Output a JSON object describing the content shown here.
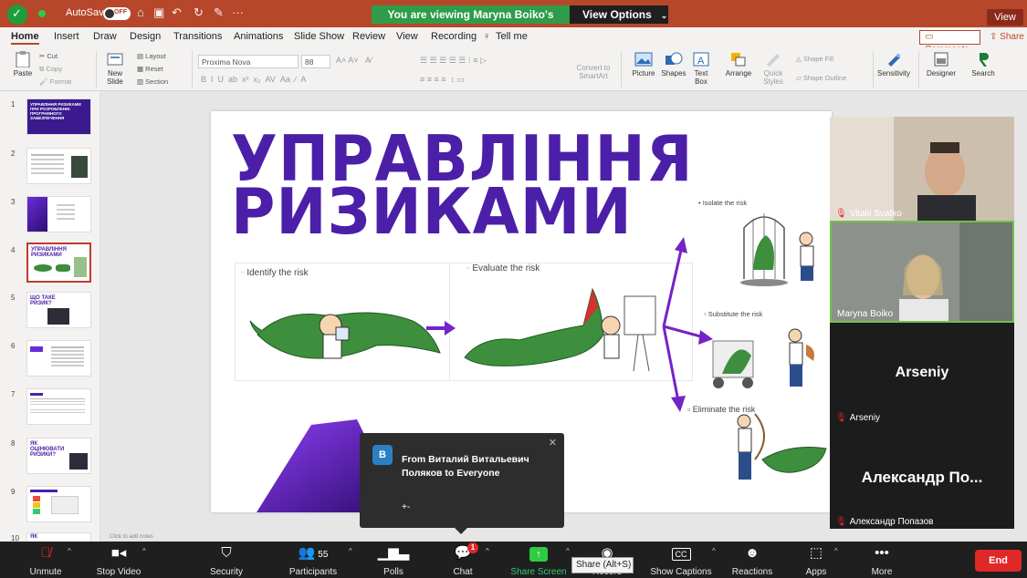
{
  "titlebar": {
    "autosave": "AutoSave",
    "autosave_state": "OFF",
    "viewing_banner": "You are viewing Maryna Boiko's screen",
    "view_options": "View Options",
    "view_button": "View"
  },
  "menubar": {
    "tabs": [
      "Home",
      "Insert",
      "Draw",
      "Design",
      "Transitions",
      "Animations",
      "Slide Show",
      "Review",
      "View",
      "Recording",
      "Tell me"
    ],
    "comments": "Comments",
    "share": "Share"
  },
  "ribbon": {
    "paste": "Paste",
    "cut": "Cut",
    "copy": "Copy",
    "format": "Format",
    "new_slide": "New Slide",
    "layout": "Layout",
    "reset": "Reset",
    "section": "Section",
    "font_name": "Proxima Nova",
    "font_size": "88",
    "convert": "Convert to SmartArt",
    "picture": "Picture",
    "shapes": "Shapes",
    "text_box": "Text Box",
    "arrange": "Arrange",
    "quick_styles": "Quick Styles",
    "shape_fill": "Shape Fill",
    "shape_outline": "Shape Outline",
    "sensitivity": "Sensitivity",
    "designer": "Designer",
    "search": "Search"
  },
  "thumbnails": [
    {
      "num": "1",
      "title": "УПРАВЛІННЯ РИЗИКАМИ ПРИ РОЗРОБЛЕННІ ПРОГРАМНОГО ЗАБЕЗПЕЧЕННЯ"
    },
    {
      "num": "2",
      "title": ""
    },
    {
      "num": "3",
      "title": ""
    },
    {
      "num": "4",
      "title": "УПРАВЛІННЯ РИЗИКАМИ"
    },
    {
      "num": "5",
      "title": "ЩО ТАКЕ РИЗИК?"
    },
    {
      "num": "6",
      "title": ""
    },
    {
      "num": "7",
      "title": ""
    },
    {
      "num": "8",
      "title": "ЯК ОЦІНЮВАТИ РИЗИКИ?"
    },
    {
      "num": "9",
      "title": ""
    },
    {
      "num": "10",
      "title": "ЯК"
    }
  ],
  "slide": {
    "title_line1": "УПРАВЛІННЯ",
    "title_line2": "РИЗИКАМИ",
    "identify": "Identify the risk",
    "evaluate": "Evaluate the risk",
    "isolate": "Isolate the risk",
    "substitute": "Substitute the risk",
    "eliminate": "Eliminate the risk"
  },
  "statusbar": {
    "notes_hint": "Click to add notes"
  },
  "participants": [
    {
      "name": "Vitalii Svatko",
      "muted": true
    },
    {
      "name": "Maryna Boiko",
      "muted": false
    },
    {
      "name": "Arseniy",
      "display": "Arseniy",
      "muted": true
    },
    {
      "name": "Александр Попазов",
      "display": "Александр По...",
      "muted": true
    }
  ],
  "chat_popup": {
    "avatar_letter": "В",
    "from": "From Виталий Витальевич Поляков to Everyone",
    "message": "+-"
  },
  "toolbar": {
    "unmute": "Unmute",
    "stop_video": "Stop Video",
    "security": "Security",
    "participants": "Participants",
    "participants_count": "55",
    "polls": "Polls",
    "chat": "Chat",
    "chat_badge": "1",
    "share_screen": "Share Screen",
    "record": "Record",
    "show_captions": "Show Captions",
    "reactions": "Reactions",
    "apps": "Apps",
    "more": "More",
    "end": "End",
    "tooltip": "Share (Alt+S)"
  },
  "colors": {
    "ppt_accent": "#b7472a",
    "slide_purple": "#4c1fa8",
    "zoom_green": "#2e9c49",
    "end_red": "#e02828"
  }
}
